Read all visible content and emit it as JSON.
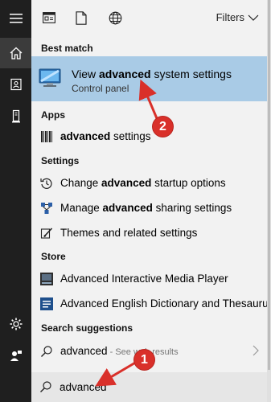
{
  "top": {
    "filters_label": "Filters"
  },
  "sections": {
    "best_match": "Best match",
    "apps": "Apps",
    "settings": "Settings",
    "store": "Store",
    "search_suggestions": "Search suggestions"
  },
  "best_match": {
    "title_prefix": "View ",
    "title_bold": "advanced",
    "title_suffix": " system settings",
    "subtitle": "Control panel"
  },
  "apps": [
    {
      "bold": "advanced",
      "rest": " settings",
      "icon": "barcode-icon"
    }
  ],
  "settings": [
    {
      "pre": "Change ",
      "bold": "advanced",
      "rest": " startup options",
      "icon": "history-icon"
    },
    {
      "pre": "Manage ",
      "bold": "advanced",
      "rest": " sharing settings",
      "icon": "share-icon"
    },
    {
      "pre": "Themes and related settings",
      "bold": "",
      "rest": "",
      "icon": "brush-icon"
    }
  ],
  "store": [
    {
      "label": "Advanced Interactive Media Player",
      "icon": "media-player-icon"
    },
    {
      "label": "Advanced English Dictionary and Thesaurus",
      "icon": "dictionary-icon"
    }
  ],
  "suggestion": {
    "query": "advanced",
    "hint": " - See web results"
  },
  "search": {
    "value": "advanced"
  },
  "annotations": {
    "one": "1",
    "two": "2"
  },
  "colors": {
    "rail": "#1f1f1f",
    "highlight": "#a9cbe6",
    "annotation": "#d9302a"
  }
}
